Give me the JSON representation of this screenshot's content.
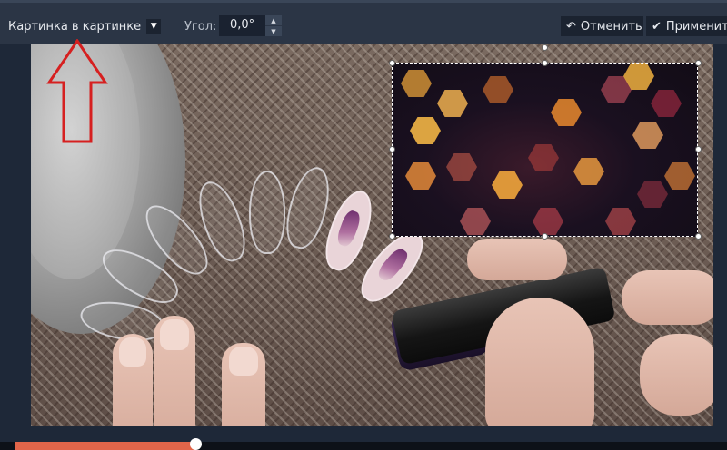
{
  "toolbar": {
    "mode_label": "Картинка в картинке",
    "angle_label": "Угол:",
    "angle_value": "0,0°",
    "cancel_label": "Отменить",
    "apply_label": "Применить"
  },
  "timeline": {
    "progress": 0.26
  },
  "colors": {
    "toolbar_bg": "#2b3545",
    "accent": "#e1654a",
    "arrow": "#d62020"
  },
  "icons": {
    "mode_dropdown": "chevron-down-icon",
    "cancel": "undo-icon",
    "apply": "check-icon",
    "angle_up": "spin-up-icon",
    "angle_down": "spin-down-icon"
  }
}
